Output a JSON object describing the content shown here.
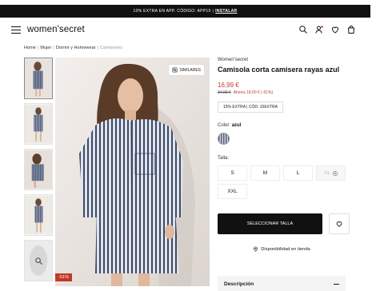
{
  "promo_bar": {
    "text": "10% EXTRA EN APP. CÓDIGO: APP10",
    "separator": "|",
    "link": "INSTALAR"
  },
  "header": {
    "logo": "women'secret",
    "icons": [
      "menu-icon",
      "search-icon",
      "user-icon",
      "heart-icon",
      "bag-icon"
    ]
  },
  "breadcrumb": {
    "items": [
      "Home",
      "Mujer",
      "Dormir y Homewear"
    ],
    "current": "Camisones",
    "separator": "|"
  },
  "gallery": {
    "similares_label": "SIMILARES",
    "discount_badge": "-51%"
  },
  "product": {
    "brand": "Women'secret",
    "title": "Camisola corta camisera rayas azul",
    "price": "16,99 €",
    "old_price": "34,99 €",
    "savings": "Ahorra 18,00 € (-51%)",
    "promo_code": "15% EXTRA | CÓD: 15EXTRA",
    "color_label": "Color:",
    "color_value": "azul",
    "size_label": "Talla:",
    "sizes": [
      "S",
      "M",
      "L",
      "XL",
      "XXL"
    ]
  },
  "actions": {
    "buy_label": "SELECCIONAR TALLA",
    "availability_label": "Disponibilidad en tienda"
  },
  "accordion": {
    "description_label": "Descripción"
  },
  "colors": {
    "accent_red": "#c0392b",
    "dark": "#111111"
  }
}
